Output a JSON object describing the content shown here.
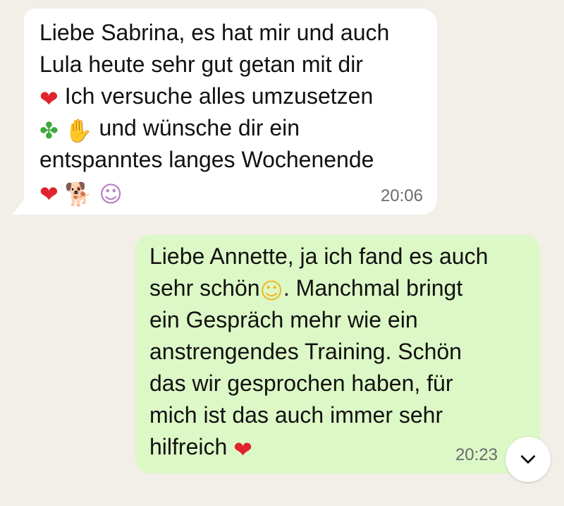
{
  "messages": [
    {
      "direction": "incoming",
      "lines": [
        "Liebe Sabrina, es hat mir und auch",
        "Lula heute sehr gut getan mit dir",
        "Ich versuche alles umzusetzen",
        "und wünsche dir ein",
        "entspanntes langes Wochenende"
      ],
      "time": "20:06",
      "bubble_color": "#ffffff"
    },
    {
      "direction": "outgoing",
      "lines": [
        "Liebe Annette, ja ich fand es auch",
        "sehr schön",
        ". Manchmal bringt",
        "ein Gespräch mehr wie ein",
        "anstrengendes Training. Schön",
        "das wir gesprochen haben, für",
        "mich ist das auch immer sehr",
        "hilfreich"
      ],
      "time": "20:23",
      "bubble_color": "#dcf8c6"
    }
  ],
  "emojis": {
    "heart": "❤",
    "clover": "✤",
    "hands": "✋",
    "dog": "🐕",
    "person": "☺",
    "smile": "☺"
  },
  "scroll_button_icon": "chevron-down-icon",
  "colors": {
    "background": "#f2eee8",
    "incoming_bubble": "#ffffff",
    "outgoing_bubble": "#dcf8c6",
    "timestamp": "#6b6b6b"
  }
}
